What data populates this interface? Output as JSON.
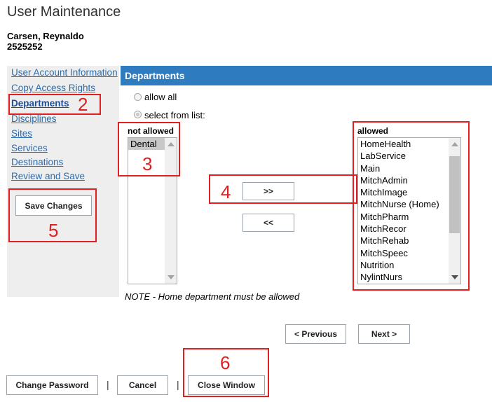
{
  "page": {
    "title": "User Maintenance",
    "user_name": "Carsen, Reynaldo",
    "user_id": "2525252"
  },
  "sidebar": {
    "items": [
      {
        "label": "User Account Information",
        "active": false
      },
      {
        "label": "Copy Access Rights",
        "active": false
      },
      {
        "label": "Departments",
        "active": true
      },
      {
        "label": "Disciplines",
        "active": false
      },
      {
        "label": "Sites",
        "active": false
      },
      {
        "label": "Services",
        "active": false
      },
      {
        "label": "Destinations",
        "active": false
      },
      {
        "label": "Review and Save",
        "active": false
      }
    ],
    "save_label": "Save Changes"
  },
  "departments": {
    "header": "Departments",
    "allow_all_label": "allow all",
    "select_label": "select from list:",
    "selected_option": "select from list:",
    "not_allowed_title": "not allowed",
    "not_allowed": [
      "Dental"
    ],
    "allowed_title": "allowed",
    "allowed": [
      "HomeHealth",
      "LabService",
      "Main",
      "MitchAdmin",
      "MitchImage",
      "MitchNurse (Home)",
      "MitchPharm",
      "MitchRecor",
      "MitchRehab",
      "MitchSpeec",
      "Nutrition",
      "NylintNurs"
    ],
    "move_right_label": ">>",
    "move_left_label": "<<",
    "note": "NOTE - Home department must be allowed"
  },
  "nav": {
    "previous_label": "< Previous",
    "next_label": "Next >"
  },
  "footer": {
    "change_password_label": "Change Password",
    "cancel_label": "Cancel",
    "close_label": "Close Window",
    "separator": "|"
  },
  "annotations": [
    "2",
    "3",
    "4",
    "5",
    "6"
  ],
  "colors": {
    "header_bg": "#2e7bbf",
    "annotation": "#e02020",
    "link": "#2b6cb0"
  }
}
